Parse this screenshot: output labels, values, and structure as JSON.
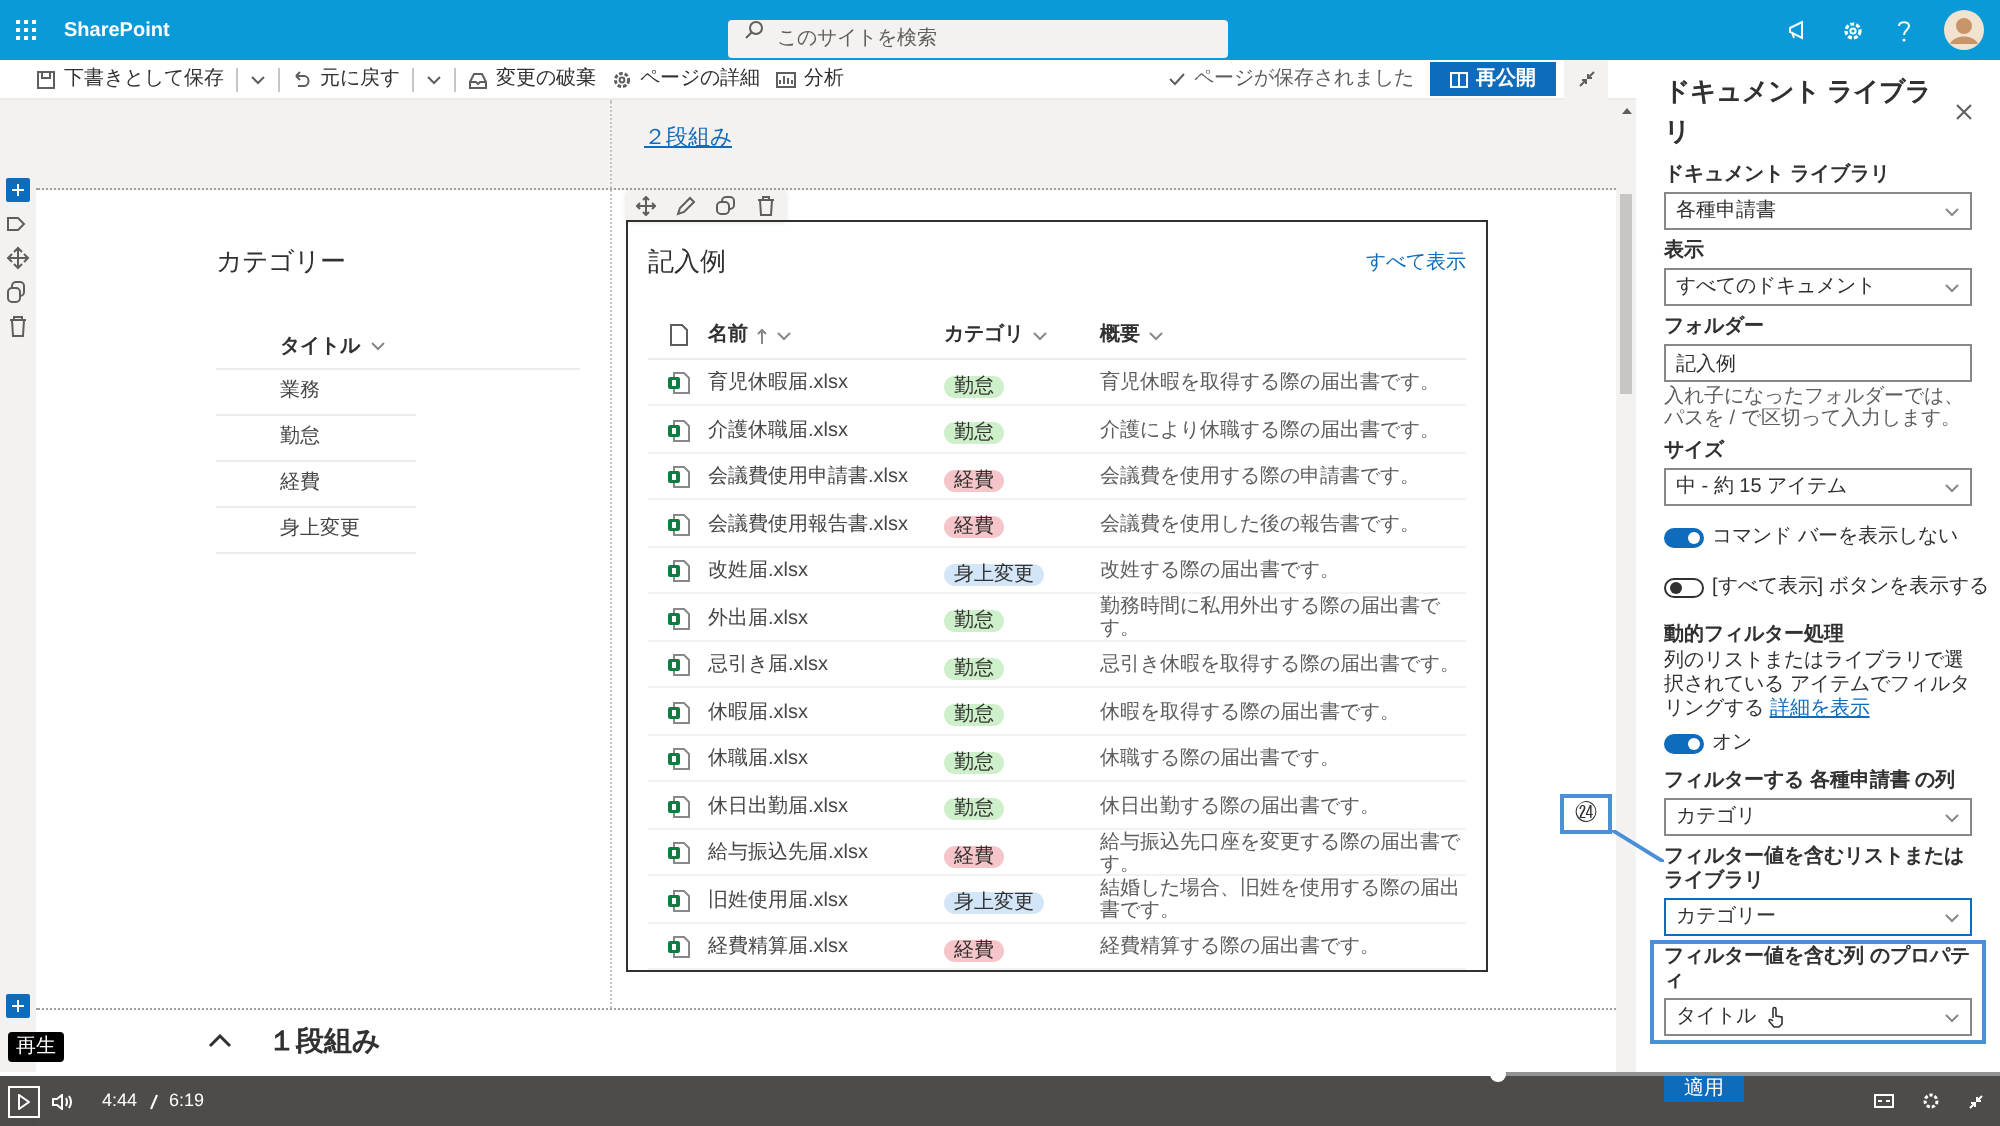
{
  "topbar": {
    "app": "SharePoint",
    "search": {
      "placeholder": "このサイトを検索"
    }
  },
  "toolbar": {
    "items": [
      {
        "label": "下書きとして保存",
        "dropdown": true
      },
      {
        "label": "元に戻す",
        "dropdown": true
      },
      {
        "label": "変更の破棄",
        "dropdown": false
      },
      {
        "label": "ページの詳細",
        "dropdown": false
      },
      {
        "label": "分析",
        "dropdown": false
      }
    ],
    "status": "ページが保存されました",
    "publish": "再公開"
  },
  "canvas": {
    "top_section": {
      "link": "２段組み"
    },
    "categories": {
      "title": "カテゴリー",
      "column": "タイトル",
      "rows": [
        "業務",
        "勤怠",
        "経費",
        "身上変更"
      ]
    },
    "library": {
      "title": "記入例",
      "see_all": "すべて表示",
      "columns": [
        {
          "label": "名前",
          "sorted": true
        },
        {
          "label": "カテゴリ",
          "sorted": false
        },
        {
          "label": "概要",
          "sorted": false
        }
      ],
      "rows": [
        {
          "name": "育児休暇届.xlsx",
          "category": "勤怠",
          "color": "#cdefc9",
          "summary": "育児休暇を取得する際の届出書です。"
        },
        {
          "name": "介護休職届.xlsx",
          "category": "勤怠",
          "color": "#cdefc9",
          "summary": "介護により休職する際の届出書です。"
        },
        {
          "name": "会議費使用申請書.xlsx",
          "category": "経費",
          "color": "#f6c5c9",
          "summary": "会議費を使用する際の申請書です。"
        },
        {
          "name": "会議費使用報告書.xlsx",
          "category": "経費",
          "color": "#f6c5c9",
          "summary": "会議費を使用した後の報告書です。"
        },
        {
          "name": "改姓届.xlsx",
          "category": "身上変更",
          "color": "#d3e6f7",
          "summary": "改姓する際の届出書です。"
        },
        {
          "name": "外出届.xlsx",
          "category": "勤怠",
          "color": "#cdefc9",
          "summary": "勤務時間に私用外出する際の届出書です。"
        },
        {
          "name": "忌引き届.xlsx",
          "category": "勤怠",
          "color": "#cdefc9",
          "summary": "忌引き休暇を取得する際の届出書です。"
        },
        {
          "name": "休暇届.xlsx",
          "category": "勤怠",
          "color": "#cdefc9",
          "summary": "休暇を取得する際の届出書です。"
        },
        {
          "name": "休職届.xlsx",
          "category": "勤怠",
          "color": "#cdefc9",
          "summary": "休職する際の届出書です。"
        },
        {
          "name": "休日出勤届.xlsx",
          "category": "勤怠",
          "color": "#cdefc9",
          "summary": "休日出勤する際の届出書です。"
        },
        {
          "name": "給与振込先届.xlsx",
          "category": "経費",
          "color": "#f6c5c9",
          "summary": "給与振込先口座を変更する際の届出書です。"
        },
        {
          "name": "旧姓使用届.xlsx",
          "category": "身上変更",
          "color": "#d3e6f7",
          "summary": "結婚した場合、旧姓を使用する際の届出書です。"
        },
        {
          "name": "経費精算届.xlsx",
          "category": "経費",
          "color": "#f6c5c9",
          "summary": "経費精算する際の届出書です。"
        }
      ]
    },
    "bottom_section": {
      "title": "１段組み"
    }
  },
  "panel": {
    "title": "ドキュメント ライブラリ",
    "fields": [
      {
        "kind": "select",
        "label": "ドキュメント ライブラリ",
        "value": "各種申請書",
        "focused": false,
        "highlighted": false
      },
      {
        "kind": "select",
        "label": "表示",
        "value": "すべてのドキュメント",
        "focused": false,
        "highlighted": false
      },
      {
        "kind": "text",
        "label": "フォルダー",
        "value": "記入例",
        "hint": "入れ子になったフォルダーでは、パスを / で区切って入力します。"
      },
      {
        "kind": "select",
        "label": "サイズ",
        "value": "中 - 約 15 アイテム",
        "focused": false,
        "highlighted": false
      },
      {
        "kind": "toggle",
        "label": "コマンド バーを表示しない",
        "on": true
      },
      {
        "kind": "toggle",
        "label": "[すべて表示] ボタンを表示する",
        "on": false
      },
      {
        "kind": "filter",
        "label": "動的フィルター処理",
        "description": "列のリストまたはライブラリで選択されている アイテムでフィルタリングする",
        "link": "詳細を表示",
        "toggle_label": "オン",
        "on": true
      },
      {
        "kind": "select",
        "label": "フィルターする 各種申請書 の列",
        "value": "カテゴリ",
        "focused": false,
        "highlighted": false
      },
      {
        "kind": "select",
        "label": "フィルター値を含むリストまたはライブラリ",
        "value": "カテゴリー",
        "focused": true,
        "highlighted": false
      },
      {
        "kind": "select",
        "label": "フィルター値を含む列 のプロパティ",
        "value": "タイトル",
        "focused": false,
        "highlighted": true
      }
    ],
    "apply": "適用"
  },
  "annotation": {
    "number": "㉔"
  },
  "video": {
    "tooltip": "再生",
    "time": "4:44",
    "duration": "6:19",
    "level": 0.749
  }
}
